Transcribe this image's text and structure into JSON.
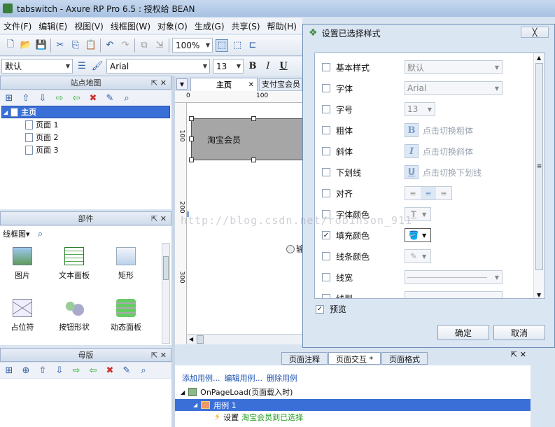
{
  "window": {
    "title": "tabswitch - Axure RP Pro 6.5 : 授权给 BEAN"
  },
  "menu": [
    "文件(F)",
    "编辑(E)",
    "视图(V)",
    "线框图(W)",
    "对象(O)",
    "生成(G)",
    "共享(S)",
    "帮助(H)"
  ],
  "toolbar": {
    "zoom": "100%",
    "style_combo": "默认",
    "font": "Arial",
    "font_size": "13",
    "bold": "B",
    "italic": "I",
    "underline": "U"
  },
  "sitemap": {
    "title": "站点地图",
    "root": "主页",
    "pages": [
      "页面 1",
      "页面 2",
      "页面 3"
    ]
  },
  "widgets": {
    "title": "部件",
    "library": "线框图▾",
    "items": [
      "图片",
      "文本面板",
      "矩形",
      "占位符",
      "按钮形状",
      "动态面板"
    ]
  },
  "masters": {
    "title": "母版"
  },
  "editor": {
    "tabs": [
      "主页",
      "支付宝会员"
    ],
    "ruler_h": [
      "0",
      "100"
    ],
    "ruler_v": [
      "100",
      "200",
      "300"
    ],
    "shape_text": "淘宝会员",
    "radio_text": "输"
  },
  "dialog": {
    "title": "设置已选择样式",
    "close": "╳",
    "rows": [
      {
        "label": "基本样式",
        "checked": false,
        "value": "默认"
      },
      {
        "label": "字体",
        "checked": false,
        "value": "Arial"
      },
      {
        "label": "字号",
        "checked": false,
        "value": "13"
      },
      {
        "label": "粗体",
        "checked": false,
        "btn": "B",
        "hint": "点击切换粗体"
      },
      {
        "label": "斜体",
        "checked": false,
        "btn": "I",
        "hint": "点击切换斜体"
      },
      {
        "label": "下划线",
        "checked": false,
        "btn": "U",
        "hint": "点击切换下划线"
      },
      {
        "label": "对齐",
        "checked": false
      },
      {
        "label": "字体颜色",
        "checked": false,
        "btn": "T"
      },
      {
        "label": "填充颜色",
        "checked": true
      },
      {
        "label": "线条颜色",
        "checked": false
      },
      {
        "label": "线宽",
        "checked": false
      },
      {
        "label": "线型",
        "checked": false
      }
    ],
    "preview_label": "预览",
    "ok": "确定",
    "cancel": "取消"
  },
  "bottom": {
    "tabs": [
      "页面注释",
      "页面交互 *",
      "页面格式"
    ],
    "links": [
      "添加用例...",
      "编辑用例...",
      "删除用例"
    ],
    "event": "OnPageLoad(页面载入时)",
    "case": "用例 1",
    "action_prefix": "设置",
    "action_target": "淘宝会员到已选择"
  },
  "watermark": "http://blog.csdn.net/robinson_911",
  "colors": {
    "selection": "#3a6fd8",
    "shape_fill": "#a6a6a6",
    "action_green": "#1a9a1a"
  }
}
